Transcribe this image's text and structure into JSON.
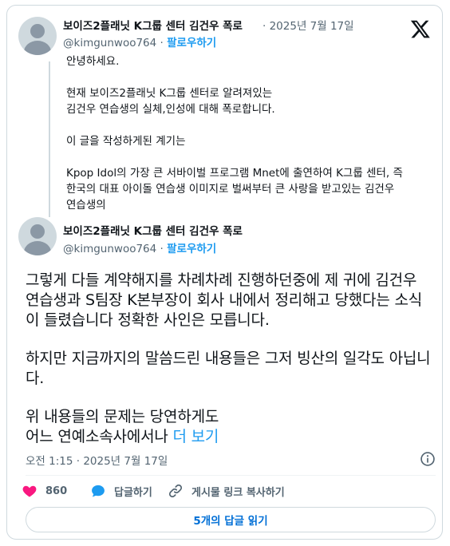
{
  "quoted_tweet": {
    "author_name": "보이즈2플래닛 K그룹 센터 김건우 폭로",
    "date": "· 2025년 7월 17일",
    "handle": "@kimgunwoo764",
    "separator": "·",
    "follow_label": "팔로우하기",
    "paragraphs": [
      "안녕하세요.",
      "현재 보이즈2플래닛 K그룹 센터로 알려져있는\n김건우 연습생의 실체,인성에 대해 폭로합니다.",
      "이 글을 작성하게된 계기는",
      "Kpop Idol의 가장 큰 서바이벌 프로그램 Mnet에 출연하여 K그룹 센터, 즉\n한국의 대표 아이돌 연습생 이미지로 벌써부터 큰 사랑을 받고있는 김건우\n연습생의"
    ]
  },
  "tweet": {
    "author_name": "보이즈2플래닛 K그룹 센터 김건우 폭로",
    "handle": "@kimgunwoo764",
    "separator": "·",
    "follow_label": "팔로우하기",
    "paragraphs": [
      "그렇게 다들 계약해지를 차례차례 진행하던중에 제 귀에 김건우 연습생과 S팀장 K본부장이 회사 내에서 정리해고 당했다는 소식이 들렸습니다 정확한 사인은 모릅니다.",
      "하지만 지금까지의 말씀드린 내용들은 그저 빙산의 일각도 아닙니다."
    ],
    "last_line_1": "위 내용들의 문제는 당연하게도",
    "last_line_2": "어느 연예소속사에서나",
    "more_label": "더 보기",
    "timestamp": "오전 1:15 · 2025년 7월 17일"
  },
  "actions": {
    "like_count": "860",
    "reply_label": "답글하기",
    "copy_link_label": "게시물 링크 복사하기"
  },
  "read_replies_label": "5개의 답글 읽기",
  "colors": {
    "accent": "#1d9bf0",
    "like": "#f91880",
    "muted": "#536471",
    "border": "#cfd9de"
  },
  "icons": {
    "logo": "x-logo-icon",
    "like": "heart-icon",
    "reply": "speech-bubble-icon",
    "link": "link-icon",
    "info": "info-icon"
  }
}
